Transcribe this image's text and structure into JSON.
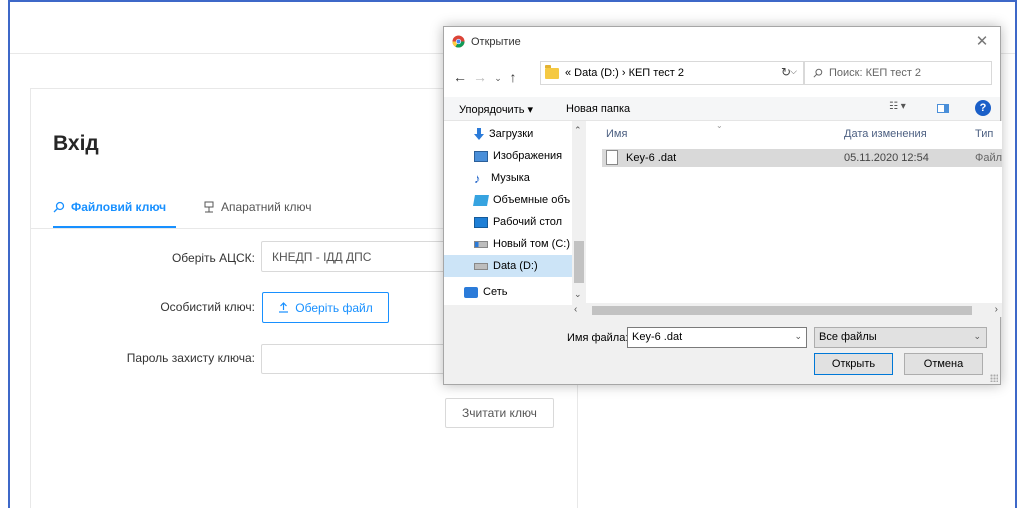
{
  "page": {
    "title": "Вхід",
    "tabs": [
      {
        "label": "Файловий ключ",
        "active": true
      },
      {
        "label": "Апаратний ключ",
        "active": false
      }
    ],
    "form": {
      "acsk_label": "Оберіть АЦСК:",
      "acsk_value": "КНЕДП - ІДД ДПС",
      "key_label": "Особистий ключ:",
      "choose_file": "Оберіть файл",
      "password_label": "Пароль захисту ключа:",
      "read_key": "Зчитати ключ"
    },
    "colors": {
      "accent": "#1890ff",
      "frame": "#3e68c8"
    }
  },
  "dialog": {
    "title": "Открытие",
    "close_glyph": "✕",
    "nav": {
      "back": "←",
      "forward": "→",
      "recent": "⌄",
      "up": "↑",
      "refresh": "↻"
    },
    "breadcrumb": "«  Data (D:)  ›  КЕП тест 2",
    "search_placeholder": "Поиск: КЕП тест 2",
    "toolbar": {
      "organize": "Упорядочить ▾",
      "new_folder": "Новая папка",
      "view": "☷ ▾",
      "help": "?"
    },
    "nav_items": [
      {
        "label": "Загрузки",
        "icon": "downloads-icon"
      },
      {
        "label": "Изображения",
        "icon": "images-icon"
      },
      {
        "label": "Музыка",
        "icon": "music-icon"
      },
      {
        "label": "Объемные объ",
        "icon": "3d-objects-icon"
      },
      {
        "label": "Рабочий стол",
        "icon": "desktop-icon"
      },
      {
        "label": "Новый том (C:)",
        "icon": "drive-icon"
      },
      {
        "label": "Data (D:)",
        "icon": "drive-icon",
        "selected": true
      },
      {
        "label": "Сеть",
        "icon": "network-icon"
      }
    ],
    "columns": {
      "name": "Имя",
      "date": "Дата изменения",
      "type": "Тип"
    },
    "files": [
      {
        "name": "Key-6 .dat",
        "date": "05.11.2020 12:54",
        "type": "Файл"
      }
    ],
    "filename_label": "Имя файла:",
    "filename_value": "Key-6 .dat",
    "filetype_value": "Все файлы",
    "open_button": "Открыть",
    "cancel_button": "Отмена"
  }
}
